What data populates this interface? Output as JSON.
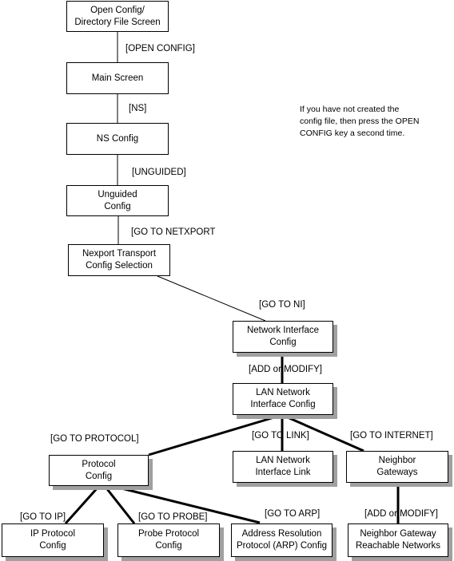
{
  "nodes": {
    "open_config": "Open Config/\nDirectory File Screen",
    "main_screen": "Main Screen",
    "ns_config": "NS Config",
    "unguided_config": "Unguided\nConfig",
    "nexport_transport": "Nexport  Transport\nConfig Selection",
    "network_interface": "Network Interface\nConfig",
    "lan_ni_config": "LAN Network\nInterface Config",
    "protocol_config": "Protocol\nConfig",
    "lan_ni_link": "LAN Network\nInterface Link",
    "neighbor_gateways": "Neighbor\nGateways",
    "ip_protocol": "IP Protocol\nConfig",
    "probe_protocol": "Probe Protocol\nConfig",
    "arp_config": "Address Resolution\nProtocol (ARP) Config",
    "ng_reachable": "Neighbor Gateway\nReachable Networks"
  },
  "edges": {
    "open_config": "[OPEN CONFIG]",
    "ns": "[NS]",
    "unguided": "[UNGUIDED]",
    "go_to_netxport": "[GO TO NETXPORT",
    "go_to_ni": "[GO TO NI]",
    "add_or_modify_1": "[ADD or MODIFY]",
    "go_to_protocol": "[GO TO PROTOCOL]",
    "go_to_link": "[GO TO LINK]",
    "go_to_internet": "[GO TO INTERNET]",
    "go_to_ip": "[GO TO IP]",
    "go_to_probe": "[GO TO PROBE]",
    "go_to_arp": "[GO TO ARP]",
    "add_or_modify_2": "[ADD or MODIFY]"
  },
  "note": "If you have not created the config file, then press the OPEN CONFIG key a second time.",
  "colors": {
    "line": "#000000",
    "shadow": "#a0a0a0",
    "background": "#ffffff"
  }
}
